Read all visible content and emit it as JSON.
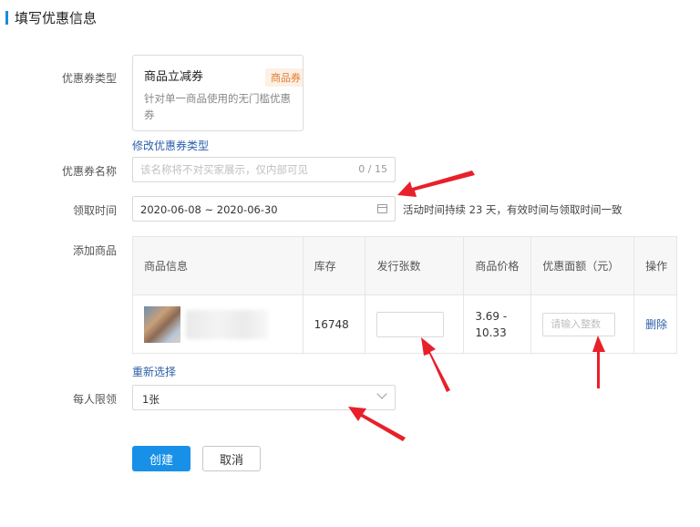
{
  "section": {
    "title": "填写优惠信息"
  },
  "labels": {
    "coupon_type": "优惠券类型",
    "coupon_name": "优惠券名称",
    "claim_time": "领取时间",
    "add_goods": "添加商品",
    "per_person_limit": "每人限领"
  },
  "coupon_card": {
    "name": "商品立减券",
    "tag": "商品券",
    "description": "针对单一商品使用的无门槛优惠券"
  },
  "modify_coupon_type_link": "修改优惠券类型",
  "name_input": {
    "placeholder": "该名称将不对买家展示，仅内部可见",
    "value": "",
    "counter": "0 / 15"
  },
  "date_range": {
    "value": "2020-06-08 ~ 2020-06-30",
    "note": "活动时间持续 23 天，有效时间与领取时间一致"
  },
  "table": {
    "headers": {
      "info": "商品信息",
      "stock": "库存",
      "issue_qty": "发行张数",
      "price": "商品价格",
      "discount": "优惠面额（元）",
      "action": "操作"
    },
    "rows": [
      {
        "stock": "16748",
        "price": "3.69 - 10.33",
        "discount_placeholder": "请输入整数",
        "delete": "删除"
      }
    ]
  },
  "reselect_link": "重新选择",
  "limit_select": {
    "value": "1张"
  },
  "buttons": {
    "create": "创建",
    "cancel": "取消"
  },
  "colors": {
    "accent": "#1890e8",
    "link": "#2b5fa8",
    "annotation_arrow": "#e8202a",
    "tag_text": "#e07b2e"
  }
}
